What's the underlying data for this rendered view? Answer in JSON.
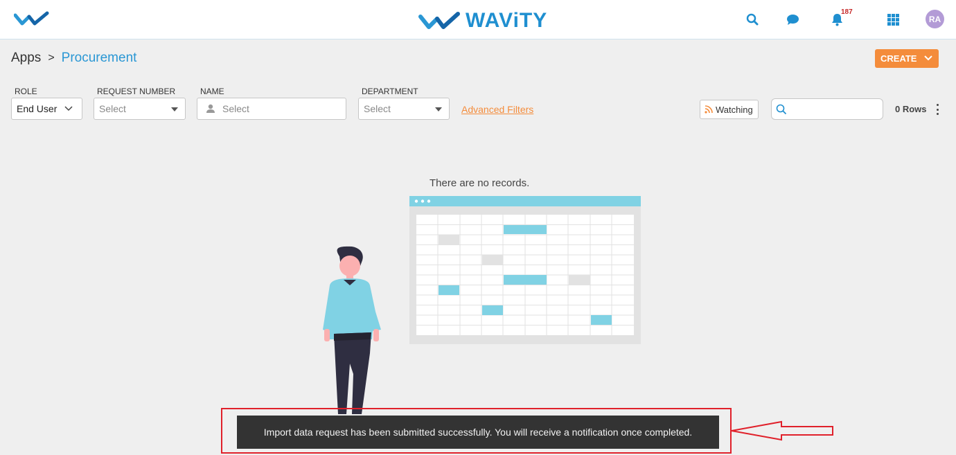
{
  "header": {
    "brand_name": "WAViTY",
    "notification_count": "187",
    "avatar_initials": "RA",
    "icons": [
      "search-icon",
      "chat-icon",
      "bell-icon",
      "apps-grid-icon"
    ]
  },
  "breadcrumb": {
    "root": "Apps",
    "separator": ">",
    "current": "Procurement"
  },
  "actions": {
    "create_label": "CREATE"
  },
  "filters": {
    "role": {
      "label": "ROLE",
      "value": "End User"
    },
    "request_number": {
      "label": "REQUEST NUMBER",
      "placeholder": "Select"
    },
    "name": {
      "label": "NAME",
      "placeholder": "Select"
    },
    "department": {
      "label": "DEPARTMENT",
      "placeholder": "Select"
    },
    "advanced_filters_label": "Advanced Filters"
  },
  "toolbar": {
    "watching_label": "Watching",
    "search_placeholder": "",
    "rows_label": "0 Rows"
  },
  "empty_state": {
    "message": "There are no records."
  },
  "toast": {
    "message": "Import data request has been submitted successfully. You will receive a notification once completed."
  },
  "colors": {
    "accent": "#2a97d4",
    "create_button": "#f48c3b",
    "illustration_blue": "#80d2e4",
    "annotation_red": "#e0202a"
  }
}
